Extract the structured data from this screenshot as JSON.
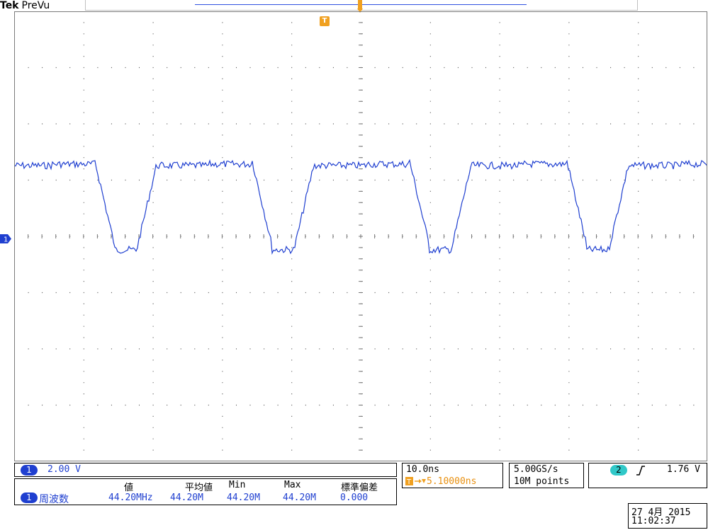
{
  "header": {
    "brand": "Tek",
    "mode": "PreVu",
    "trigger_marker": "T"
  },
  "channel1": {
    "marker": "1",
    "scale": "2.00 V",
    "color": "#1f3fd0"
  },
  "measurements": {
    "channel": "1",
    "label": "周波数",
    "columns": [
      "値",
      "平均値",
      "Min",
      "Max",
      "標準偏差"
    ],
    "values": [
      "44.20MHz",
      "44.20M",
      "44.20M",
      "44.20M",
      "0.000"
    ]
  },
  "timebase": {
    "scale": "10.0ns",
    "trigger_position": "5.10000ns"
  },
  "acquisition": {
    "sample_rate": "5.00GS/s",
    "record_length": "10M points"
  },
  "trigger": {
    "source": "2",
    "slope_icon": "rising-edge-icon",
    "level": "1.76 V",
    "source_color": "#30c8c8"
  },
  "datetime": {
    "date": "27 4月  2015",
    "time": "11:02:37"
  }
}
